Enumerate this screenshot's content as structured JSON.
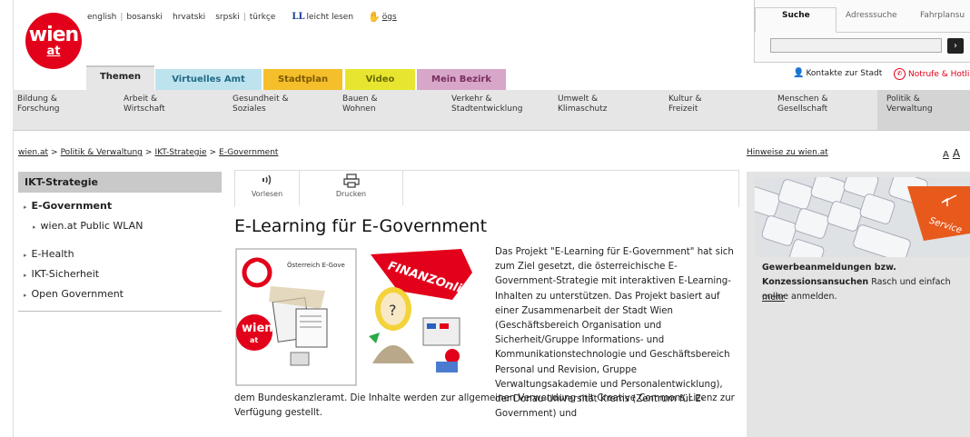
{
  "header": {
    "logo_top": "wien",
    "logo_bottom": "at",
    "languages": [
      "english",
      "bosanski",
      "hrvatski",
      "srpski",
      "türkçe"
    ],
    "easy_read_icon": "LL",
    "easy_read_label": "leicht lesen",
    "sign_language_label": "ögs"
  },
  "search": {
    "tabs": [
      "Suche",
      "Adresssuche",
      "Fahrplansu"
    ],
    "input_value": "",
    "go_symbol": "›"
  },
  "utility": {
    "contact_label": "Kontakte zur Stadt",
    "emergency_label": "Notrufe & Hotli"
  },
  "main_tabs": [
    "Themen",
    "Virtuelles Amt",
    "Stadtplan",
    "Video",
    "Mein Bezirk"
  ],
  "categories": [
    {
      "line1": "Bildung &",
      "line2": "Forschung"
    },
    {
      "line1": "Arbeit &",
      "line2": "Wirtschaft"
    },
    {
      "line1": "Gesundheit &",
      "line2": "Soziales"
    },
    {
      "line1": "Bauen &",
      "line2": "Wohnen"
    },
    {
      "line1": "Verkehr &",
      "line2": "Stadtentwicklung"
    },
    {
      "line1": "Umwelt &",
      "line2": "Klimaschutz"
    },
    {
      "line1": "Kultur &",
      "line2": "Freizeit"
    },
    {
      "line1": "Menschen &",
      "line2": "Gesellschaft"
    },
    {
      "line1": "Politik &",
      "line2": "Verwaltung"
    }
  ],
  "breadcrumb": [
    "wien.at",
    "Politik & Verwaltung",
    "IKT-Strategie",
    "E-Government"
  ],
  "hints_link": "Hinweise zu wien.at",
  "font_size_small": "A",
  "font_size_large": "A",
  "sidebar": {
    "heading": "IKT-Strategie",
    "items": [
      {
        "label": "E-Government"
      },
      {
        "label": "wien.at Public WLAN"
      },
      {
        "label": "E-Health"
      },
      {
        "label": "IKT-Sicherheit"
      },
      {
        "label": "Open Government"
      }
    ]
  },
  "toolbar": {
    "read_label": "Vorlesen",
    "print_label": "Drucken"
  },
  "article": {
    "title": "E-Learning für E-Government",
    "paragraph_wrapped": "Das Projekt \"E-Learning für E-Government\" hat sich zum Ziel gesetzt, die österreichische E-Government-Strategie mit interaktiven E-Learning-Inhalten zu unterstützen. Das Projekt basiert auf einer Zusammenarbeit der Stadt Wien (Geschäftsbereich Organisation und Sicherheit/Gruppe Informations- und Kommunikationstechnologie und Geschäftsbereich Personal und Revision, Gruppe Verwaltungsakademie und Personalentwicklung), der Donau-Universität Krems (Zentrum für E-Government) und",
    "paragraph_full": "dem Bundeskanzleramt. Die Inhalte werden zur allgemeinen Verwendung mit Creative Commons Lizenz zur Verfügung gestellt.",
    "illustration": {
      "finanz_label": "FINANZOnline",
      "country_label": "Österreich E-Gove",
      "logo_top": "wien",
      "logo_bottom": "at"
    }
  },
  "teaser": {
    "title_bold": "Gewerbeanmeldungen bzw. Konzessionsansuchen",
    "text": "Rasch und einfach online anmelden.",
    "more_label": "mehr",
    "key_label": "Service"
  },
  "colors": {
    "brand_red": "#e2001a",
    "tab_amt": "#bde3ee",
    "tab_plan": "#f5bf2b",
    "tab_video": "#e8e530",
    "tab_bezirk": "#d7a6c9"
  }
}
